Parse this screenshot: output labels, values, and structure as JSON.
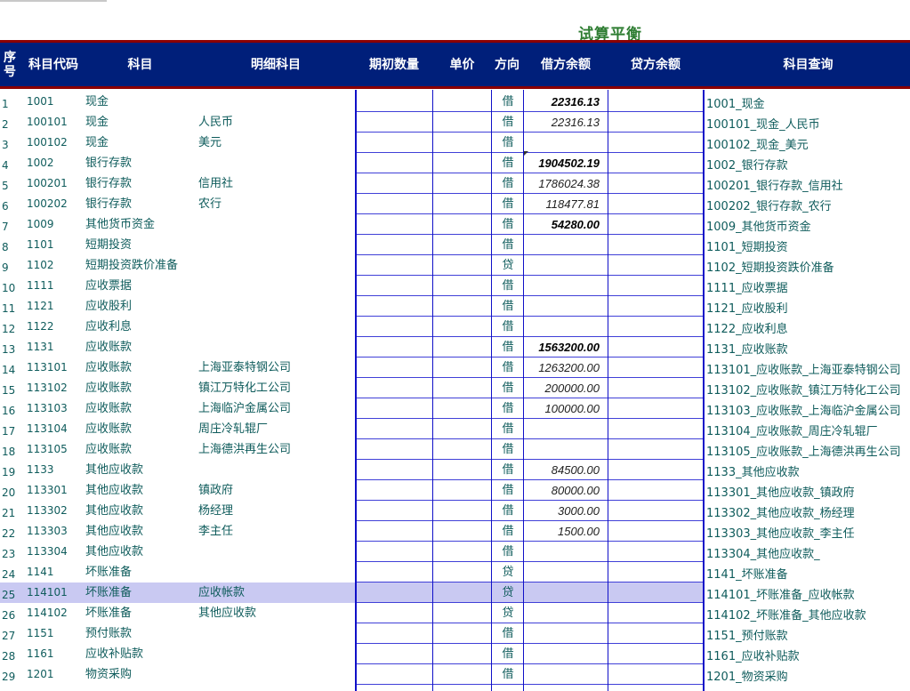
{
  "title": "试算平衡",
  "headers": {
    "seq": "序号",
    "code": "科目代码",
    "name": "科目",
    "detail": "明细科目",
    "qty": "期初数量",
    "price": "单价",
    "dir": "方向",
    "debit": "借方余额",
    "credit": "贷方余额",
    "query": "科目查询"
  },
  "highlight_row": 25,
  "rows": [
    {
      "seq": "1",
      "code": "1001",
      "name": "现金",
      "detail": "",
      "dir": "借",
      "debit": "22316.13",
      "bold": true,
      "query": "1001_现金"
    },
    {
      "seq": "2",
      "code": "100101",
      "name": "现金",
      "detail": "人民币",
      "dir": "借",
      "debit": "22316.13",
      "bold": false,
      "query": "100101_现金_人民币"
    },
    {
      "seq": "3",
      "code": "100102",
      "name": "现金",
      "detail": "美元",
      "dir": "借",
      "debit": "",
      "bold": false,
      "query": "100102_现金_美元"
    },
    {
      "seq": "4",
      "code": "1002",
      "name": "银行存款",
      "detail": "",
      "dir": "借",
      "debit": "1904502.19",
      "bold": true,
      "query": "1002_银行存款"
    },
    {
      "seq": "5",
      "code": "100201",
      "name": "银行存款",
      "detail": "信用社",
      "dir": "借",
      "debit": "1786024.38",
      "bold": false,
      "query": "100201_银行存款_信用社"
    },
    {
      "seq": "6",
      "code": "100202",
      "name": "银行存款",
      "detail": "农行",
      "dir": "借",
      "debit": "118477.81",
      "bold": false,
      "query": "100202_银行存款_农行"
    },
    {
      "seq": "7",
      "code": "1009",
      "name": "其他货币资金",
      "detail": "",
      "dir": "借",
      "debit": "54280.00",
      "bold": true,
      "query": "1009_其他货币资金"
    },
    {
      "seq": "8",
      "code": "1101",
      "name": "短期投资",
      "detail": "",
      "dir": "借",
      "debit": "",
      "bold": false,
      "query": "1101_短期投资"
    },
    {
      "seq": "9",
      "code": "1102",
      "name": "短期投资跌价准备",
      "detail": "",
      "dir": "贷",
      "debit": "",
      "bold": false,
      "query": "1102_短期投资跌价准备"
    },
    {
      "seq": "10",
      "code": "1111",
      "name": "应收票据",
      "detail": "",
      "dir": "借",
      "debit": "",
      "bold": false,
      "query": "1111_应收票据"
    },
    {
      "seq": "11",
      "code": "1121",
      "name": "应收股利",
      "detail": "",
      "dir": "借",
      "debit": "",
      "bold": false,
      "query": "1121_应收股利"
    },
    {
      "seq": "12",
      "code": "1122",
      "name": "应收利息",
      "detail": "",
      "dir": "借",
      "debit": "",
      "bold": false,
      "query": "1122_应收利息"
    },
    {
      "seq": "13",
      "code": "1131",
      "name": "应收账款",
      "detail": "",
      "dir": "借",
      "debit": "1563200.00",
      "bold": true,
      "query": "1131_应收账款"
    },
    {
      "seq": "14",
      "code": "113101",
      "name": "应收账款",
      "detail": "上海亚泰特钢公司",
      "dir": "借",
      "debit": "1263200.00",
      "bold": false,
      "query": "113101_应收账款_上海亚泰特钢公司"
    },
    {
      "seq": "15",
      "code": "113102",
      "name": "应收账款",
      "detail": "镇江万特化工公司",
      "dir": "借",
      "debit": "200000.00",
      "bold": false,
      "query": "113102_应收账款_镇江万特化工公司"
    },
    {
      "seq": "16",
      "code": "113103",
      "name": "应收账款",
      "detail": "上海临沪金属公司",
      "dir": "借",
      "debit": "100000.00",
      "bold": false,
      "query": "113103_应收账款_上海临沪金属公司"
    },
    {
      "seq": "17",
      "code": "113104",
      "name": "应收账款",
      "detail": "周庄冷轧辊厂",
      "dir": "借",
      "debit": "",
      "bold": false,
      "query": "113104_应收账款_周庄冷轧辊厂"
    },
    {
      "seq": "18",
      "code": "113105",
      "name": "应收账款",
      "detail": "上海德洪再生公司",
      "dir": "借",
      "debit": "",
      "bold": false,
      "query": "113105_应收账款_上海德洪再生公司"
    },
    {
      "seq": "19",
      "code": "1133",
      "name": "其他应收款",
      "detail": "",
      "dir": "借",
      "debit": "84500.00",
      "bold": false,
      "query": "1133_其他应收款"
    },
    {
      "seq": "20",
      "code": "113301",
      "name": "其他应收款",
      "detail": "镇政府",
      "dir": "借",
      "debit": "80000.00",
      "bold": false,
      "query": "113301_其他应收款_镇政府"
    },
    {
      "seq": "21",
      "code": "113302",
      "name": "其他应收款",
      "detail": "杨经理",
      "dir": "借",
      "debit": "3000.00",
      "bold": false,
      "query": "113302_其他应收款_杨经理"
    },
    {
      "seq": "22",
      "code": "113303",
      "name": "其他应收款",
      "detail": "李主任",
      "dir": "借",
      "debit": "1500.00",
      "bold": false,
      "query": "113303_其他应收款_李主任"
    },
    {
      "seq": "23",
      "code": "113304",
      "name": "其他应收款",
      "detail": "",
      "dir": "借",
      "debit": "",
      "bold": false,
      "query": "113304_其他应收款_"
    },
    {
      "seq": "24",
      "code": "1141",
      "name": "坏账准备",
      "detail": "",
      "dir": "贷",
      "debit": "",
      "bold": false,
      "query": "1141_坏账准备"
    },
    {
      "seq": "25",
      "code": "114101",
      "name": "坏账准备",
      "detail": "应收帐款",
      "dir": "贷",
      "debit": "",
      "bold": false,
      "query": "114101_坏账准备_应收帐款"
    },
    {
      "seq": "26",
      "code": "114102",
      "name": "坏账准备",
      "detail": "其他应收款",
      "dir": "贷",
      "debit": "",
      "bold": false,
      "query": "114102_坏账准备_其他应收款"
    },
    {
      "seq": "27",
      "code": "1151",
      "name": "预付账款",
      "detail": "",
      "dir": "借",
      "debit": "",
      "bold": false,
      "query": "1151_预付账款"
    },
    {
      "seq": "28",
      "code": "1161",
      "name": "应收补贴款",
      "detail": "",
      "dir": "借",
      "debit": "",
      "bold": false,
      "query": "1161_应收补贴款"
    },
    {
      "seq": "29",
      "code": "1201",
      "name": "物资采购",
      "detail": "",
      "dir": "借",
      "debit": "",
      "bold": false,
      "query": "1201_物资采购"
    }
  ],
  "colors": {
    "header_bg": "#001f7a",
    "header_border": "#8b0000",
    "title": "#2e7d32",
    "text": "#0f5c5c",
    "grid": "#1010c8",
    "highlight": "#c9c9f2"
  }
}
